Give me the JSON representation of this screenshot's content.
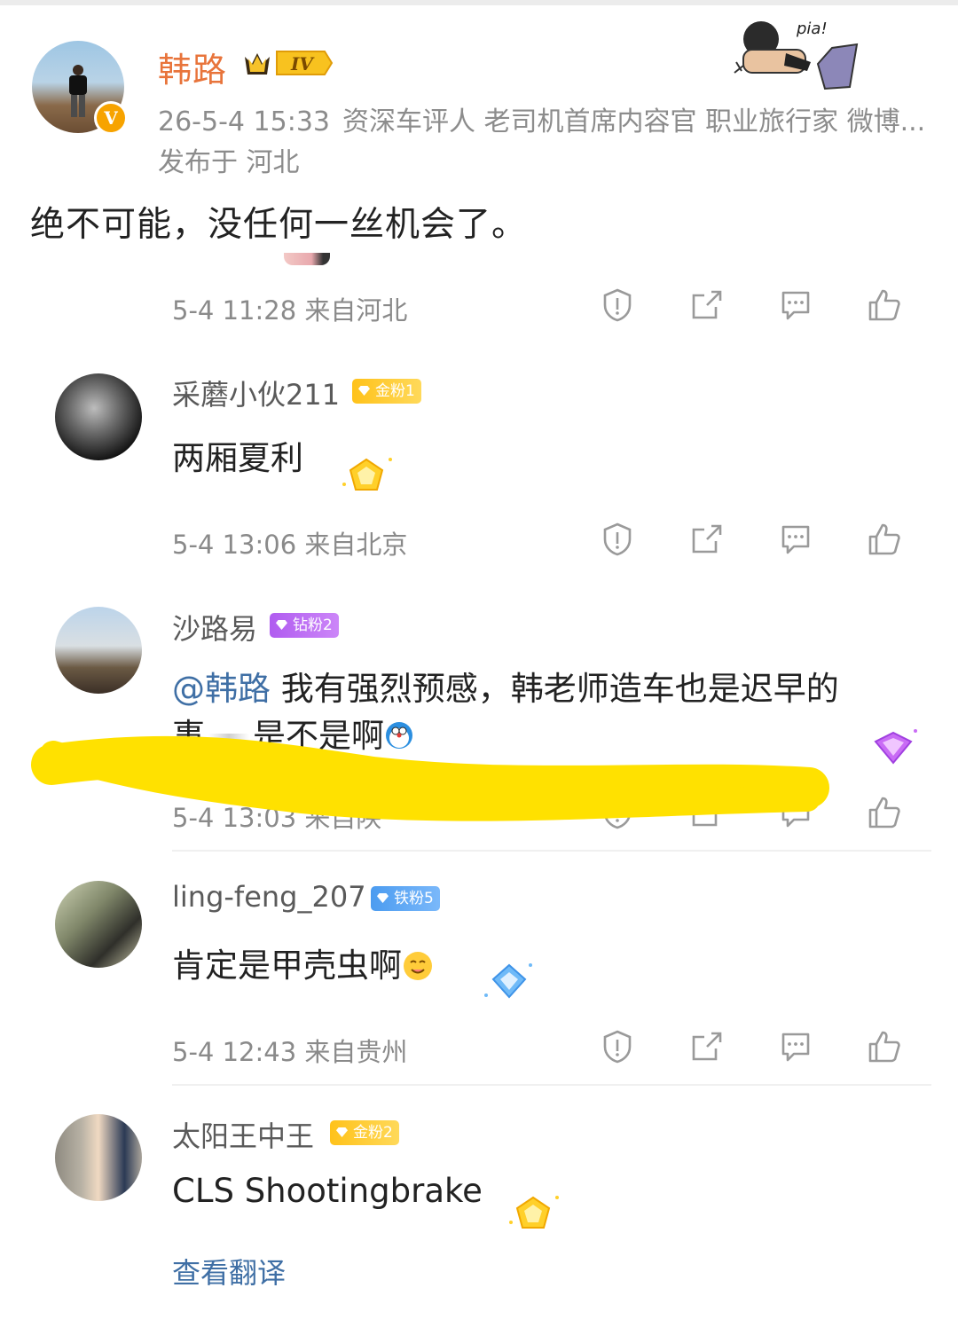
{
  "post": {
    "author": "韩路",
    "level": "IV",
    "time": "26-5-4 15:33",
    "bio": "资深车评人 老司机首席内容官 职业旅行家 微博...",
    "location": "发布于 河北",
    "text": "绝不可能，没任何一丝机会了。",
    "sticker_text": "pia!"
  },
  "rows": [
    {
      "time": "5-4 11:28  来自河北"
    },
    {
      "time": "5-4 13:06  来自北京"
    },
    {
      "time": "5-4 13:03  来自陕"
    },
    {
      "time": "5-4 12:43  来自贵州"
    }
  ],
  "comments": [
    {
      "name": "采蘑小伙211",
      "badge": "金粉1",
      "badge_type": "gold",
      "text": "两厢夏利"
    },
    {
      "name": "沙路易",
      "badge": "钻粉2",
      "badge_type": "diamond",
      "mention": "@韩路",
      "text": " 我有强烈预感，韩老师造车也是迟早的",
      "text2a": "事",
      "text2b": "是不是啊"
    },
    {
      "name": "ling-feng_207",
      "badge": "铁粉5",
      "badge_type": "iron",
      "text": "肯定是甲壳虫啊"
    },
    {
      "name": "太阳王中王",
      "badge": "金粉2",
      "badge_type": "gold",
      "text": "CLS Shootingbrake"
    }
  ],
  "translate": "查看翻译",
  "icons": [
    "report-icon",
    "share-icon",
    "comment-icon",
    "like-icon"
  ],
  "colors": {
    "author": "#e8743b",
    "link": "#3f6fa5",
    "highlight": "#ffe100"
  }
}
